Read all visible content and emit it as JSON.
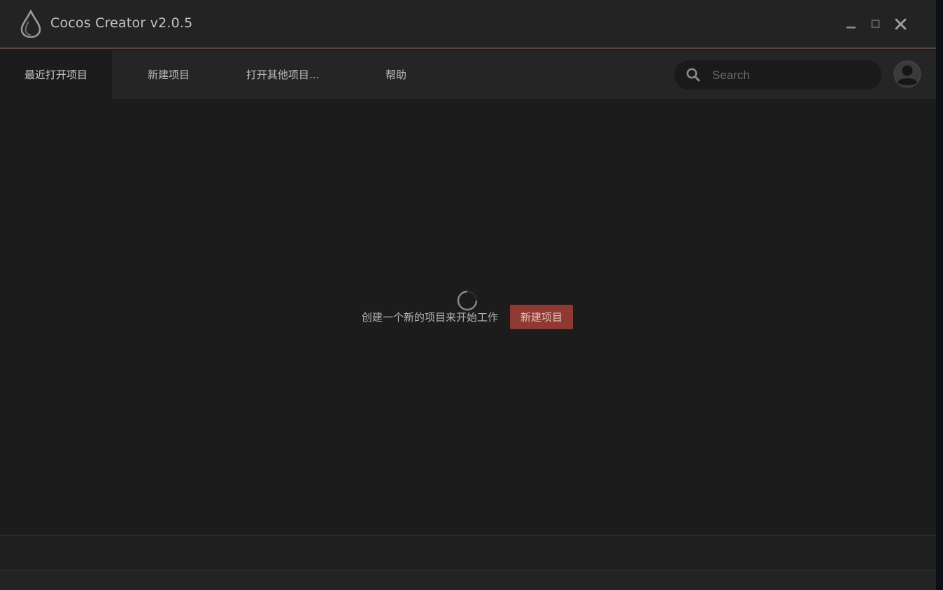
{
  "window": {
    "title": "Cocos Creator v2.0.5",
    "controls": {
      "minimize": "minimize",
      "maximize": "maximize",
      "close": "close"
    }
  },
  "nav": {
    "tabs": [
      {
        "label": "最近打开项目",
        "active": true
      },
      {
        "label": "新建项目",
        "active": false
      },
      {
        "label": "打开其他项目...",
        "active": false
      },
      {
        "label": "帮助",
        "active": false
      }
    ]
  },
  "search": {
    "placeholder": "Search",
    "value": ""
  },
  "main": {
    "empty_message": "创建一个新的项目来开始工作",
    "create_button": "新建项目"
  },
  "icons": {
    "logo": "cocos-logo-icon",
    "search": "search-icon",
    "avatar": "user-avatar-icon",
    "spinner": "loading-spinner-icon"
  },
  "colors": {
    "accent": "#8e3a32",
    "title_border": "#5a4641",
    "background": "#1c1c1c",
    "navbar": "#252525"
  }
}
